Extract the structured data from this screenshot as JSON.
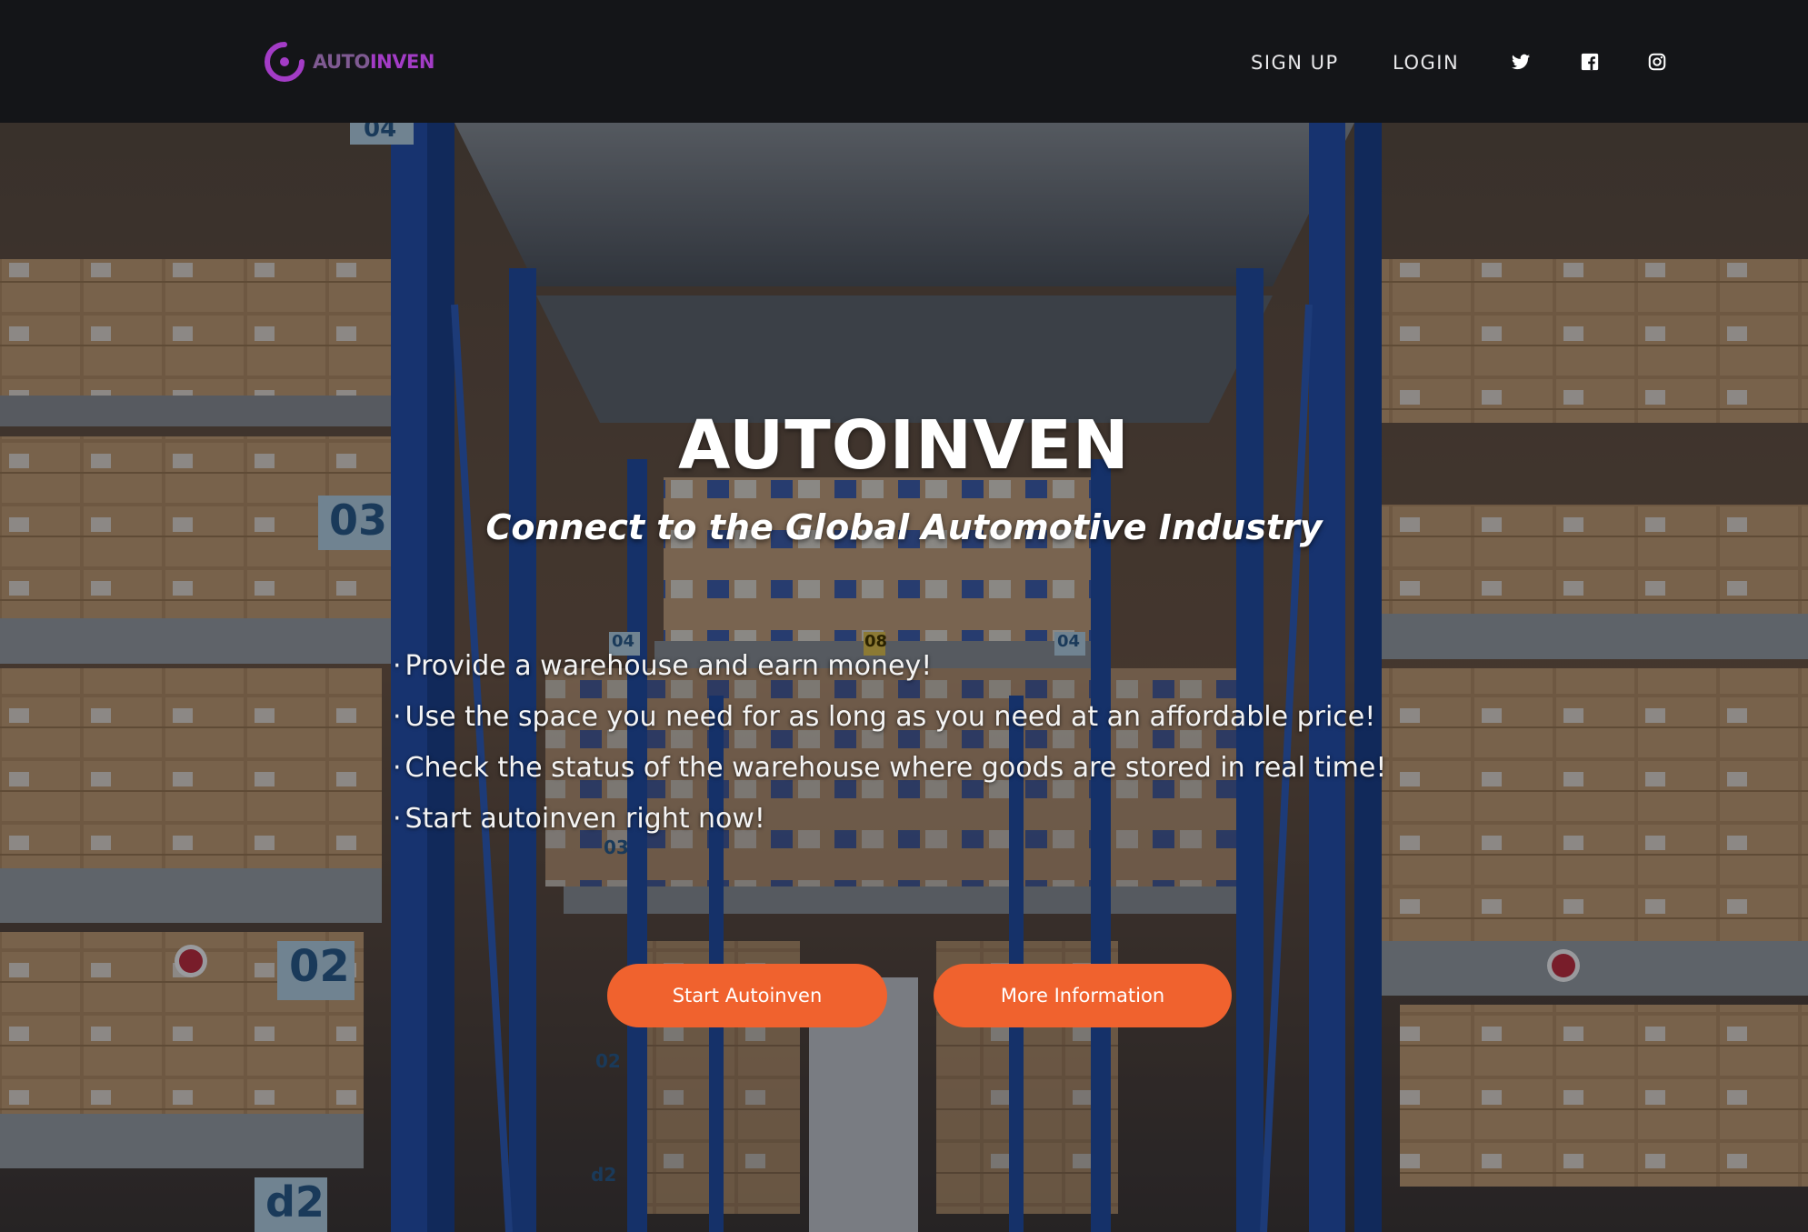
{
  "brand": {
    "name_prefix": "AUTO",
    "name_suffix": "INVEN",
    "color_prefix": "#7f5a92",
    "color_suffix": "#a33cc6"
  },
  "nav": {
    "sign_up": "SIGN UP",
    "login": "LOGIN",
    "social": [
      "twitter-icon",
      "facebook-icon",
      "instagram-icon"
    ]
  },
  "hero": {
    "title": "AUTOINVEN",
    "subtitle": "Connect to the Global Automotive Industry",
    "bullets": [
      "Provide a warehouse and earn money!",
      "Use the space you need for as long as you need at an affordable price!",
      "Check the status of the warehouse where goods are stored in real time!",
      "Start autoinven right now!"
    ],
    "bullet_marker": "·",
    "shelf_labels": [
      "04",
      "03",
      "02",
      "d2",
      "04",
      "08",
      "04",
      "03",
      "02",
      "d2"
    ],
    "buttons": {
      "start": "Start Autoinven",
      "more": "More Information"
    }
  },
  "colors": {
    "accent": "#f0622e",
    "navbar": "#141518",
    "rack_blue": "#1f4fb0"
  }
}
